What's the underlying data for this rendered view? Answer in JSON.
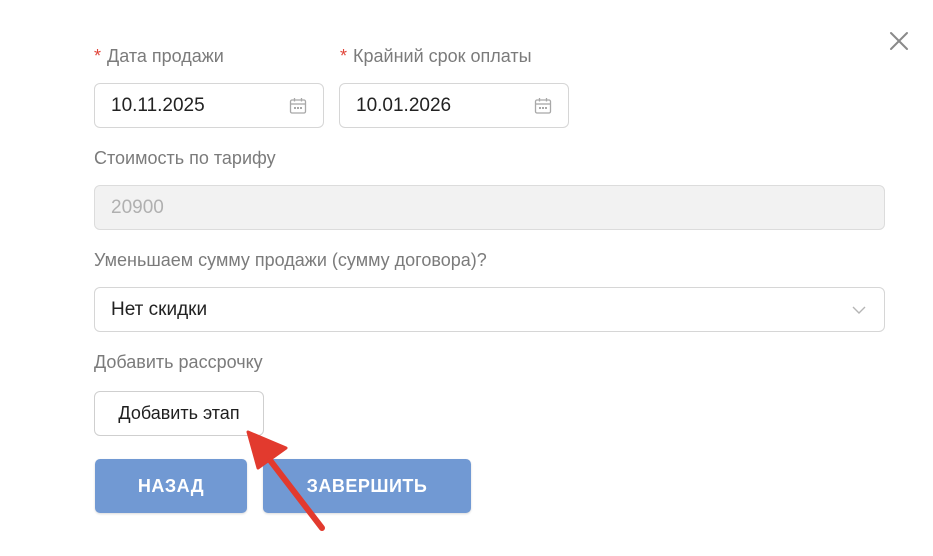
{
  "form": {
    "sale_date": {
      "required_mark": "*",
      "label": "Дата продажи",
      "value": "10.11.2025"
    },
    "payment_deadline": {
      "required_mark": "*",
      "label": "Крайний срок оплаты",
      "value": "10.01.2026"
    },
    "tariff_cost": {
      "label": "Стоимость по тарифу",
      "value": "20900"
    },
    "discount": {
      "label": "Уменьшаем сумму продажи (сумму договора)?",
      "value": "Нет скидки"
    },
    "installment": {
      "label": "Добавить рассрочку",
      "add_stage_label": "Добавить этап"
    }
  },
  "actions": {
    "back_label": "НАЗАД",
    "finish_label": "ЗАВЕРШИТЬ"
  },
  "icons": {
    "close": "close-icon",
    "calendar": "calendar-icon",
    "dropdown": "chevron-down-icon",
    "annotation": "annotation-arrow"
  },
  "colors": {
    "primary_button": "#7199d3",
    "required": "#e0453a",
    "annotation_arrow": "#e23a2e",
    "label": "#7b7b7b"
  }
}
